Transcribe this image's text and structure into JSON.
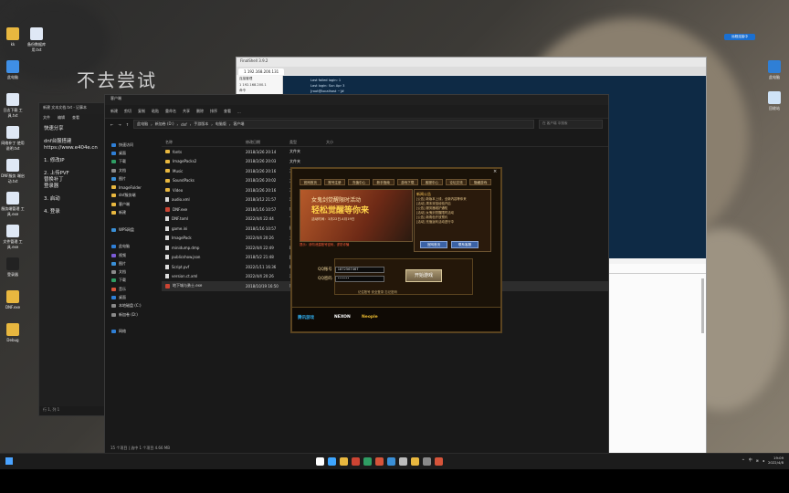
{
  "desktop": {
    "watermark_text": "不去尝试",
    "icons_left": [
      {
        "label": "kk",
        "icon": "folder-icon"
      },
      {
        "label": "备份数据库\n用.txt",
        "icon": "doc-icon"
      },
      {
        "label": "此电脑",
        "icon": "pc-icon"
      },
      {
        "label": "日志下载\n工具.txt",
        "icon": "doc-icon"
      },
      {
        "label": "网络补丁\n使用说明.txt",
        "icon": "doc-icon"
      },
      {
        "label": "DNF服务\n端启动.txt",
        "icon": "doc-icon"
      },
      {
        "label": "服务端管理\n工具.exe",
        "icon": "doc-icon"
      },
      {
        "label": "文件管理\n工具.exe",
        "icon": "doc-icon"
      },
      {
        "label": "登录器",
        "icon": "app-icon"
      },
      {
        "label": "DNF.exe",
        "icon": "folder-icon"
      },
      {
        "label": "Debug",
        "icon": "folder-icon"
      }
    ],
    "icons_right": [
      {
        "label": "此电脑",
        "icon": "monitor-icon"
      },
      {
        "label": "回收站",
        "icon": "recycle-icon"
      }
    ],
    "top_tag": "远程连接中"
  },
  "notepad": {
    "title": "新建 文本文档.txt - 记事本",
    "menu": [
      "文件",
      "编辑",
      "查看"
    ],
    "lines": [
      "快速分享",
      "",
      "dnf台服搭建",
      "https://www.e404e.cn",
      "",
      "1. 修改IP",
      "",
      "2. 上传PVF",
      "   替换补丁",
      "   登录器",
      "",
      "3. 启动",
      "",
      "4. 登录"
    ],
    "status": "行 1, 列 1"
  },
  "explorer": {
    "title": "客户端",
    "toolbar": [
      "新建",
      "剪切",
      "复制",
      "粘贴",
      "重命名",
      "共享",
      "删除",
      "排序",
      "查看",
      "..."
    ],
    "breadcrumb": [
      "此电脑",
      "新加卷 (D:)",
      "dnf",
      "手游版本",
      "电脑版",
      "客户端"
    ],
    "search_placeholder": "在 客户端 中搜索",
    "nav": [
      {
        "label": "快速访问",
        "color": "#2f7fd6"
      },
      {
        "label": "桌面",
        "color": "#2f7fd6"
      },
      {
        "label": "下载",
        "color": "#2f9d63"
      },
      {
        "label": "文档",
        "color": "#8a8a8a"
      },
      {
        "label": "图片",
        "color": "#3a8fd6"
      },
      {
        "label": "ImageFolder",
        "color": "#e8b73f"
      },
      {
        "label": "dnf服务端",
        "color": "#e8b73f"
      },
      {
        "label": "客户端",
        "color": "#e8b73f"
      },
      {
        "label": "新建",
        "color": "#e8b73f"
      },
      {
        "label": "",
        "color": "#000000"
      },
      {
        "label": "WPS网盘",
        "color": "#3a8fd6"
      },
      {
        "label": "",
        "color": "#000000"
      },
      {
        "label": "此电脑",
        "color": "#2f7fd6"
      },
      {
        "label": "视频",
        "color": "#7b5bd6"
      },
      {
        "label": "图片",
        "color": "#3a8fd6"
      },
      {
        "label": "文档",
        "color": "#8a8a8a"
      },
      {
        "label": "下载",
        "color": "#2f9d63"
      },
      {
        "label": "音乐",
        "color": "#d6543a"
      },
      {
        "label": "桌面",
        "color": "#2f7fd6"
      },
      {
        "label": "本地磁盘 (C:)",
        "color": "#8a8a8a"
      },
      {
        "label": "新加卷 (D:)",
        "color": "#8a8a8a"
      },
      {
        "label": "",
        "color": "#000000"
      },
      {
        "label": "网络",
        "color": "#2f7fd6"
      }
    ],
    "columns": [
      "名称",
      "修改日期",
      "类型",
      "大小"
    ],
    "files": [
      {
        "name": "fonts",
        "date": "2018/3/26 20:14",
        "type": "文件夹",
        "size": "",
        "kind": "folder"
      },
      {
        "name": "ImagePacks2",
        "date": "2018/2/26 20:03",
        "type": "文件夹",
        "size": "",
        "kind": "folder"
      },
      {
        "name": "Music",
        "date": "2018/2/26 20:16",
        "type": "文件夹",
        "size": "",
        "kind": "folder"
      },
      {
        "name": "SoundPacks",
        "date": "2018/2/26 20:02",
        "type": "文件夹",
        "size": "",
        "kind": "folder"
      },
      {
        "name": "Video",
        "date": "2018/2/26 20:16",
        "type": "文件夹",
        "size": "",
        "kind": "folder"
      },
      {
        "name": "audio.xml",
        "date": "2018/3/12 21:57",
        "type": "XML",
        "size": "",
        "kind": "file"
      },
      {
        "name": "DNF.exe",
        "date": "2018/1/16 10:57",
        "type": "应用",
        "size": "",
        "kind": "exe"
      },
      {
        "name": "DNF.toml",
        "date": "2022/4/4 22:44",
        "type": "TOM",
        "size": "",
        "kind": "file"
      },
      {
        "name": "game.ini",
        "date": "2018/1/16 10:57",
        "type": "配置",
        "size": "",
        "kind": "file"
      },
      {
        "name": "ImagePack",
        "date": "2022/4/4 20:26",
        "type": "文件",
        "size": "",
        "kind": "file"
      },
      {
        "name": "minidump.dmp",
        "date": "2022/4/4 22:49",
        "type": "DMP",
        "size": "",
        "kind": "file"
      },
      {
        "name": "publicshow.json",
        "date": "2018/5/2 21:48",
        "type": "JSO",
        "size": "",
        "kind": "file"
      },
      {
        "name": "Script.pvf",
        "date": "2022/1/11 16:36",
        "type": "PVF",
        "size": "",
        "kind": "file"
      },
      {
        "name": "version.ct.xml",
        "date": "2022/4/4 20:26",
        "type": "XML",
        "size": "",
        "kind": "file"
      },
      {
        "name": "地下城与勇士.exe",
        "date": "2018/10/19 16:50",
        "type": "应用",
        "size": "",
        "kind": "exe"
      }
    ],
    "status_text": "15 个项目  |  选中 1 个项目  4.66 MB"
  },
  "rdp": {
    "title": "FinalShell 3.9.2",
    "tab_label": "1 192.168.200.131",
    "left_items": [
      "连接管理",
      "1 192.168.200.1",
      "命令",
      "历史",
      "快速输入"
    ],
    "terminal_lines": [
      "Last failed login: 1",
      "Last login: Sun Apr 3",
      "[root@localhost ~]# ",
      "[root@localhost ~]# "
    ]
  },
  "game": {
    "tabs": [
      "官网首页",
      "账号注册",
      "充值中心",
      "新手指南",
      "游戏下载",
      "客服中心",
      "论坛交流",
      "隐藏游戏"
    ],
    "banner_title": "女鬼剑觉醒限时活动",
    "banner_big": "轻松觉醒等你来",
    "banner_sub": "活动时间：3月22日-4月19日",
    "notice_title": "新闻公告",
    "notice_lines": [
      "[公告] 新版本上线，全新内容等你来",
      "[活动] 周末双倍经验开启",
      "[公告] 服务器维护通知",
      "[活动] 女鬼剑觉醒限时活动",
      "[公告] 新角色开放预约",
      "[活动] 充值返利活动进行中"
    ],
    "notice_btn1": "官网首页",
    "notice_btn2": "联系客服",
    "red_text": "提示：请勿泄露账号密码，谨防诈骗",
    "account_label": "QQ账号",
    "account_value": "1872567467",
    "password_label": "QQ密码",
    "password_value": "••••••",
    "start_label": "开始游戏",
    "remember_text": "记住账号    安全登录    忘记密码",
    "logo1": "腾讯游戏",
    "logo2": "NEXON",
    "logo3": "Neople"
  },
  "taskbar": {
    "time": "19:09",
    "date": "2022/4/8",
    "lang": "中"
  }
}
